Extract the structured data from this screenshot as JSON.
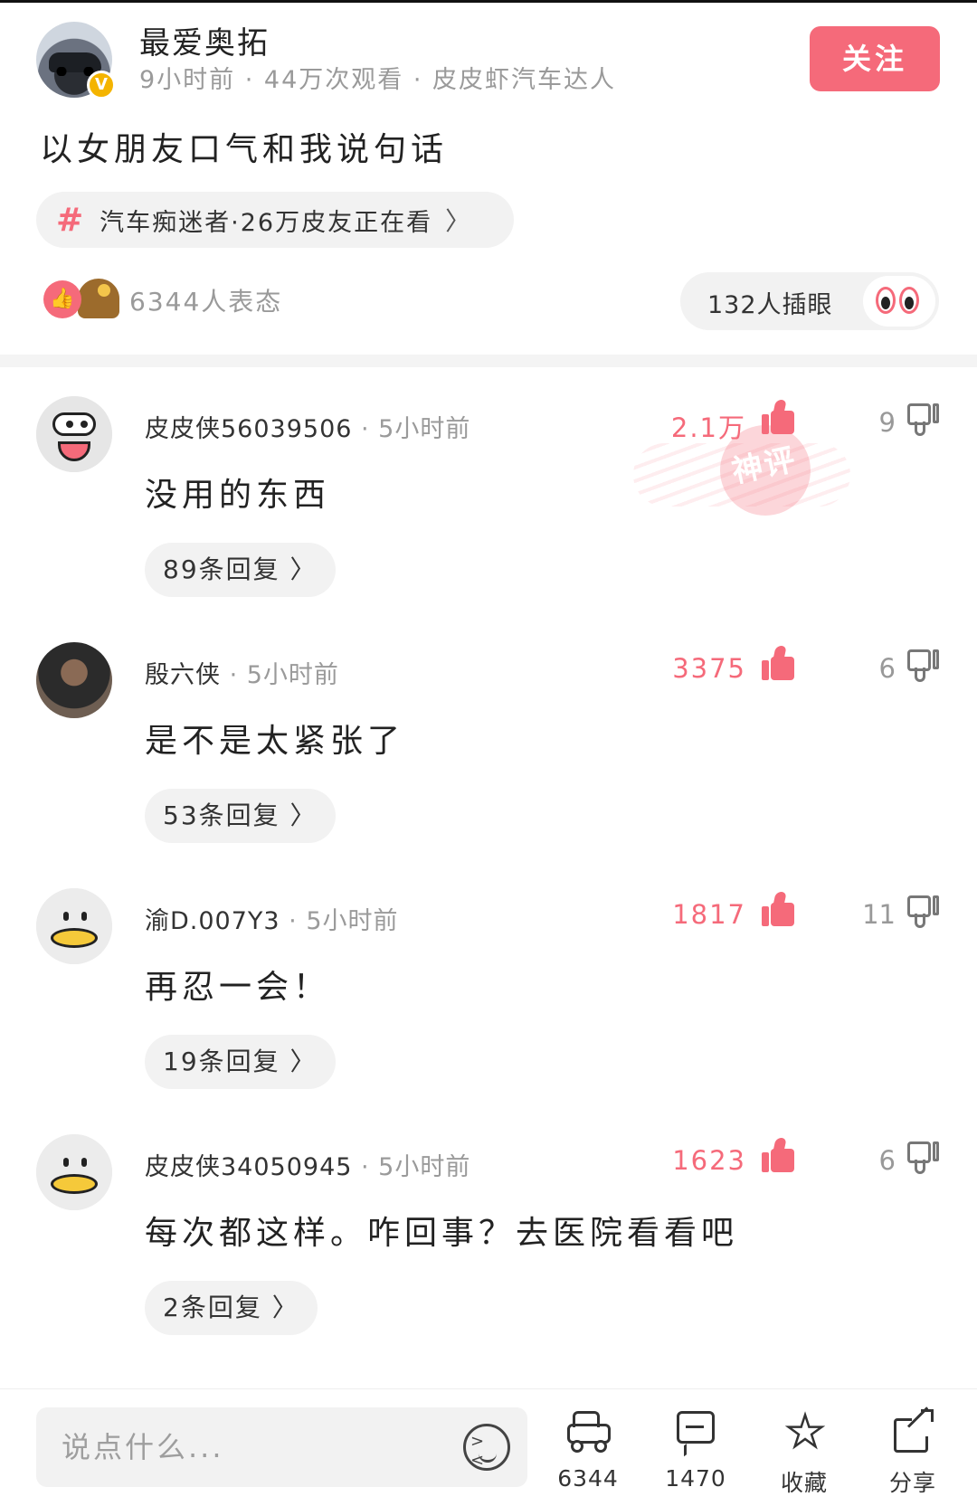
{
  "author": {
    "name": "最爱奥拓",
    "meta": "9小时前  ·  44万次观看  ·  皮皮虾汽车达人",
    "verified_icon": "v-badge-icon",
    "follow_label": "关注"
  },
  "post": {
    "title": "以女朋友口气和我说句话",
    "topic_label": "汽车痴迷者·26万皮友正在看",
    "topic_chevron": "〉",
    "reactions_count": "6344人表态",
    "peek_label": "132人插眼"
  },
  "comments": [
    {
      "user": "皮皮侠56039506",
      "time": " · 5小时前",
      "text": "没用的东西",
      "replies": "89条回复 〉",
      "likes": "2.1万",
      "dislikes": "9",
      "badge": "神评"
    },
    {
      "user": "殷六侠",
      "time": " · 5小时前",
      "text": "是不是太紧张了",
      "replies": "53条回复 〉",
      "likes": "3375",
      "dislikes": "6"
    },
    {
      "user": "渝D.007Y3",
      "time": " · 5小时前",
      "text": "再忍一会！",
      "replies": "19条回复 〉",
      "likes": "1817",
      "dislikes": "11"
    },
    {
      "user": "皮皮侠34050945",
      "time": " · 5小时前",
      "text": "每次都这样。咋回事？去医院看看吧",
      "replies": "2条回复 〉",
      "likes": "1623",
      "dislikes": "6"
    }
  ],
  "bottom_bar": {
    "input_placeholder": "说点什么...",
    "car_count": "6344",
    "comment_count": "1470",
    "favorite_label": "收藏",
    "share_label": "分享"
  },
  "colors": {
    "accent": "#f56a7a",
    "muted_text": "#9a9a9a",
    "pill_bg": "#f2f2f2"
  }
}
